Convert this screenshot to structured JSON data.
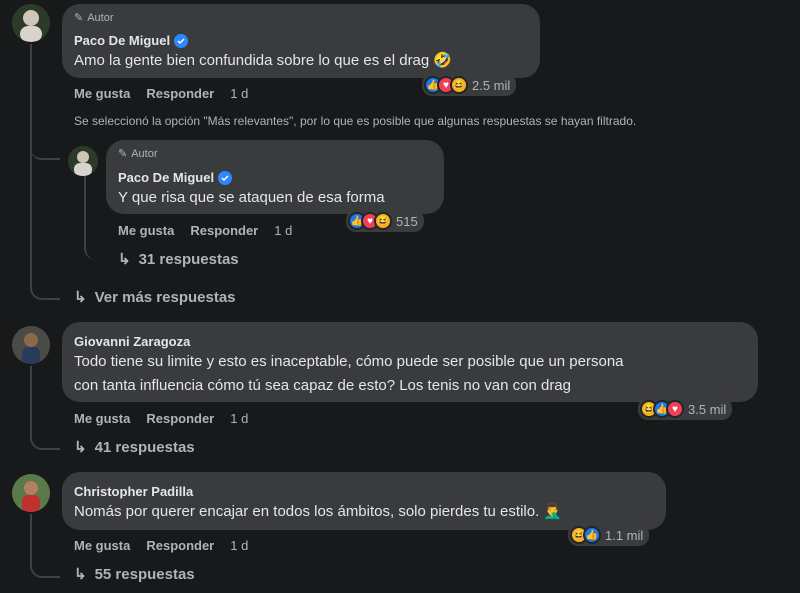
{
  "colors": {
    "background": "#18191a",
    "bubble": "#3a3b3c",
    "text": "#e4e6eb",
    "muted": "#b0b3b8",
    "like_blue": "#1877f2",
    "love_red": "#f33e58",
    "haha_yellow": "#f7b125",
    "verified_blue": "#2d88ff"
  },
  "comments": [
    {
      "author_tag": "Autor",
      "name": "Paco De Miguel",
      "verified": true,
      "lines": [
        "Amo la gente bien confundida sobre lo que es el drag 🤣"
      ],
      "actions": {
        "like": "Me gusta",
        "reply": "Responder",
        "time": "1 d"
      },
      "reactions": {
        "icons": [
          "like-icon",
          "love-icon",
          "haha-icon"
        ],
        "count": "2.5 mil"
      }
    }
  ],
  "filter_note": "Se seleccionó la opción \"Más relevantes\", por lo que es posible que algunas respuestas se hayan filtrado.",
  "reply": {
    "author_tag": "Autor",
    "name": "Paco De Miguel",
    "verified": true,
    "text": "Y que risa que se ataquen de esa forma",
    "actions": {
      "like": "Me gusta",
      "reply": "Responder",
      "time": "1 d"
    },
    "reactions": {
      "icons": [
        "like-icon",
        "love-icon",
        "haha-icon"
      ],
      "count": "515"
    },
    "replies_link": "31 respuestas"
  },
  "more_replies": "Ver más respuestas",
  "comment2": {
    "name": "Giovanni Zaragoza",
    "lines": [
      "Todo tiene su limite y esto es inaceptable, cómo puede ser posible que un persona",
      "con tanta influencia cómo tú sea capaz de esto? Los tenis no van con drag"
    ],
    "actions": {
      "like": "Me gusta",
      "reply": "Responder",
      "time": "1 d"
    },
    "reactions": {
      "icons": [
        "haha-icon",
        "like-icon",
        "love-icon"
      ],
      "count": "3.5 mil"
    },
    "replies_link": "41 respuestas"
  },
  "comment3": {
    "name": "Christopher Padilla",
    "text": "Nomás por querer encajar en todos los ámbitos, solo pierdes tu estilo. 🤦‍♂️",
    "actions": {
      "like": "Me gusta",
      "reply": "Responder",
      "time": "1 d"
    },
    "reactions": {
      "icons": [
        "haha-icon",
        "like-icon"
      ],
      "count": "1.1 mil"
    },
    "replies_link": "55 respuestas"
  }
}
